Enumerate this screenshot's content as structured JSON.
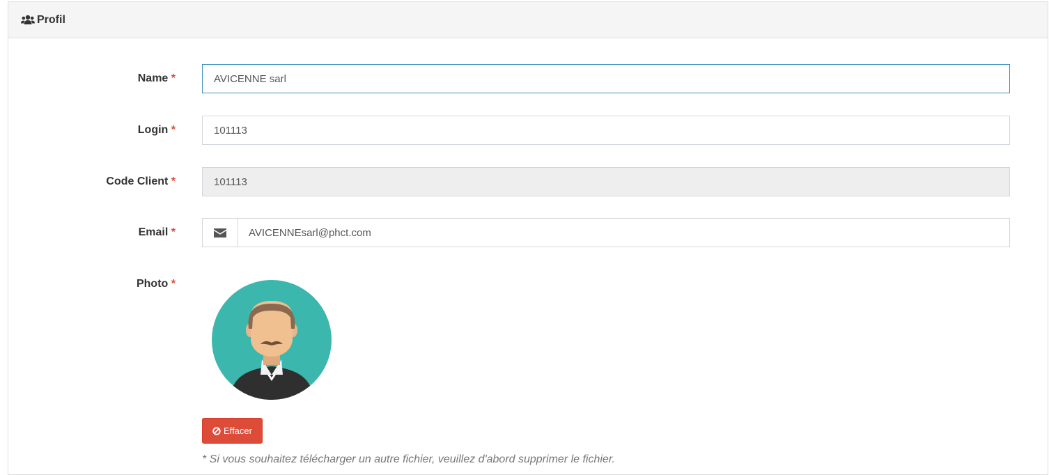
{
  "panel": {
    "title": "Profil",
    "icon": "users-icon"
  },
  "form": {
    "required_marker": "*",
    "name": {
      "label": "Name",
      "value": "AVICENNE sarl"
    },
    "login": {
      "label": "Login",
      "value": "101113"
    },
    "code_client": {
      "label": "Code Client",
      "value": "101113"
    },
    "email": {
      "label": "Email",
      "value": "AVICENNEsarl@phct.com",
      "icon": "envelope-icon"
    },
    "photo": {
      "label": "Photo"
    }
  },
  "actions": {
    "clear_label": "Effacer",
    "clear_icon": "ban-icon"
  },
  "help_text": "* Si vous souhaitez télécharger un autre fichier, veuillez d'abord supprimer le fichier.",
  "colors": {
    "danger": "#dd4b39",
    "focus_border": "#3c8dbc",
    "avatar_bg": "#3bb7ad"
  }
}
